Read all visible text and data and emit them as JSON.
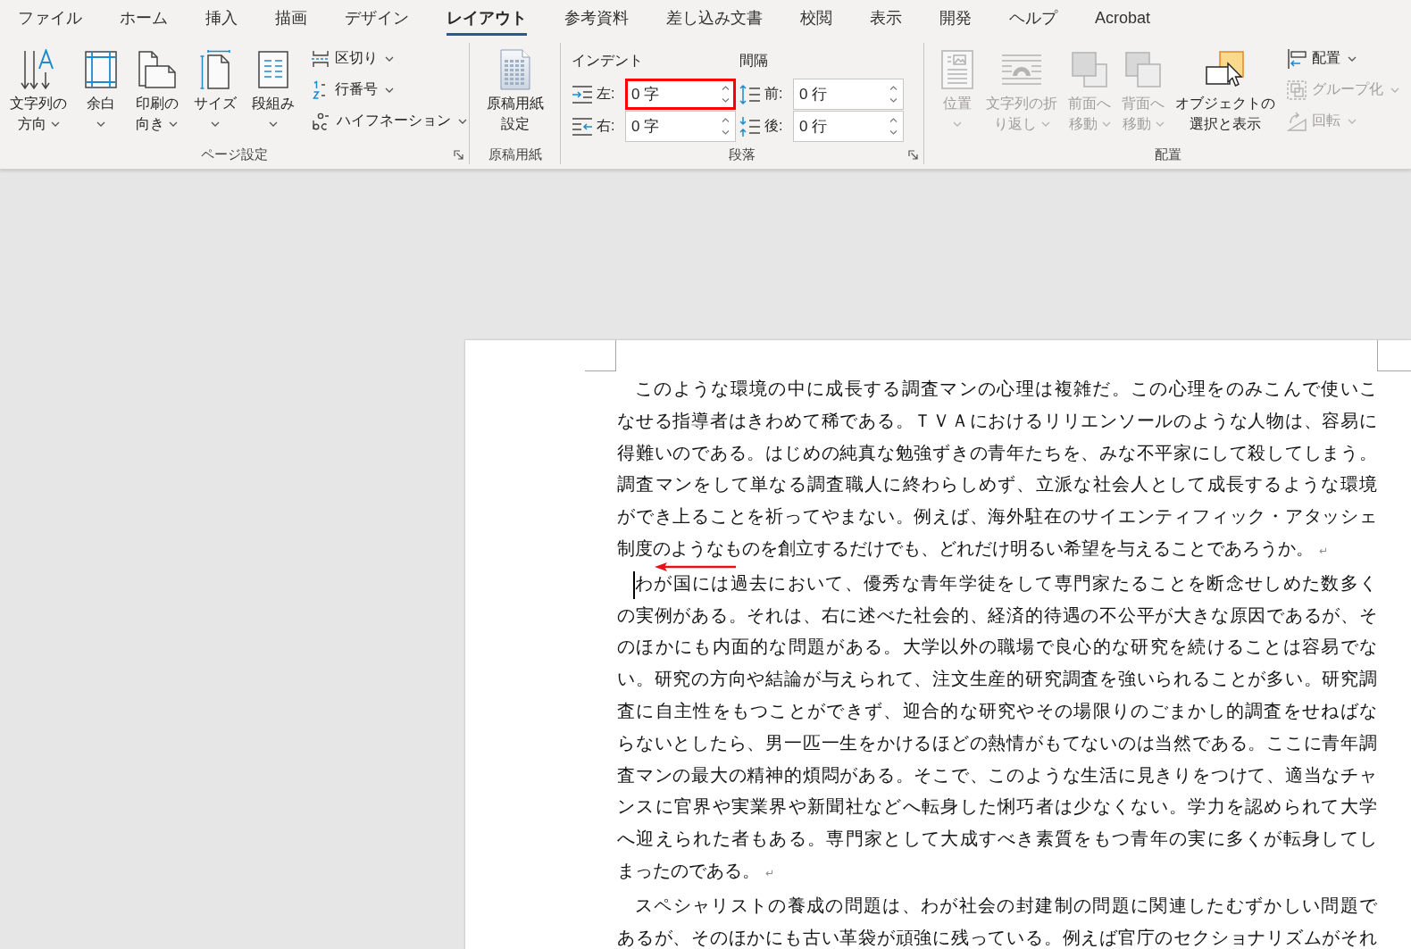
{
  "tabs": [
    {
      "label": "ファイル",
      "selected": false
    },
    {
      "label": "ホーム",
      "selected": false
    },
    {
      "label": "挿入",
      "selected": false
    },
    {
      "label": "描画",
      "selected": false
    },
    {
      "label": "デザイン",
      "selected": false
    },
    {
      "label": "レイアウト",
      "selected": true
    },
    {
      "label": "参考資料",
      "selected": false
    },
    {
      "label": "差し込み文書",
      "selected": false
    },
    {
      "label": "校閲",
      "selected": false
    },
    {
      "label": "表示",
      "selected": false
    },
    {
      "label": "開発",
      "selected": false
    },
    {
      "label": "ヘルプ",
      "selected": false
    },
    {
      "label": "Acrobat",
      "selected": false
    }
  ],
  "ribbon": {
    "groups": [
      {
        "kind": "buttons",
        "label": "ページ設定",
        "launcher": true,
        "large_buttons": [
          {
            "lines": [
              "文字列の",
              "方向"
            ],
            "dropdown": true,
            "disabled": false
          },
          {
            "lines": [
              "余白"
            ],
            "dropdown": true,
            "disabled": false
          },
          {
            "lines": [
              "印刷の",
              "向き"
            ],
            "dropdown": true,
            "disabled": false
          },
          {
            "lines": [
              "サイズ"
            ],
            "dropdown": true,
            "disabled": false
          },
          {
            "lines": [
              "段組み"
            ],
            "dropdown": true,
            "disabled": false
          }
        ],
        "small_buttons": [
          {
            "label": "区切り",
            "dropdown": true,
            "disabled": false
          },
          {
            "label": "行番号",
            "dropdown": true,
            "disabled": false
          },
          {
            "label": "ハイフネーション",
            "dropdown": true,
            "disabled": false
          }
        ]
      },
      {
        "kind": "buttons",
        "label": "原稿用紙",
        "large_buttons": [
          {
            "lines": [
              "原稿用紙",
              "設定"
            ],
            "dropdown": false,
            "disabled": false
          }
        ]
      },
      {
        "kind": "paragraph",
        "label": "段落",
        "launcher": true,
        "indent": {
          "title": "インデント",
          "fields": [
            {
              "label": "左:",
              "value": "0 字",
              "highlighted": true
            },
            {
              "label": "右:",
              "value": "0 字",
              "highlighted": false
            }
          ]
        },
        "spacing": {
          "title": "間隔",
          "fields": [
            {
              "label": "前:",
              "value": "0 行",
              "highlighted": false
            },
            {
              "label": "後:",
              "value": "0 行",
              "highlighted": false
            }
          ]
        }
      },
      {
        "kind": "buttons",
        "label": "配置",
        "large_buttons": [
          {
            "lines": [
              "位置"
            ],
            "dropdown": true,
            "disabled": true
          },
          {
            "lines": [
              "文字列の折",
              "り返し"
            ],
            "dropdown": true,
            "disabled": true
          },
          {
            "lines": [
              "前面へ",
              "移動"
            ],
            "dropdown": true,
            "disabled": true
          },
          {
            "lines": [
              "背面へ",
              "移動"
            ],
            "dropdown": true,
            "disabled": true
          },
          {
            "lines": [
              "オブジェクトの",
              "選択と表示"
            ],
            "dropdown": false,
            "disabled": false
          }
        ],
        "small_buttons": [
          {
            "label": "配置",
            "dropdown": true,
            "disabled": false
          },
          {
            "label": "グループ化",
            "dropdown": true,
            "disabled": true
          },
          {
            "label": "回転",
            "dropdown": true,
            "disabled": true
          }
        ]
      }
    ]
  },
  "document": {
    "annotation_arrow": true,
    "paragraphs": [
      {
        "cursor": false,
        "end_mark": "↵",
        "lines": [
          "このような環境の中に成長する調査マンの心理は複雑だ。この心理をのみこんで使いこ",
          "なせる指導者はきわめて稀である。ＴＶＡにおけるリリエンソールのような人物は、容易に",
          "得難いのである。はじめの純真な勉強ずきの青年たちを、みな不平家にして殺してしまう。",
          "調査マンをして単なる調査職人に終わらしめず、立派な社会人として成長するような環境",
          "ができ上ることを祈ってやまない。例えば、海外駐在のサイエンティフィック・アタッシェ",
          "制度のようなものを創立するだけでも、どれだけ明るい希望を与えることであろうか。"
        ]
      },
      {
        "cursor": true,
        "end_mark": "↵",
        "lines": [
          "わが国には過去において、優秀な青年学徒をして専門家たることを断念せしめた数多く",
          "の実例がある。それは、右に述べた社会的、経済的待遇の不公平が大きな原因であるが、そ",
          "のほかにも内面的な問題がある。大学以外の職場で良心的な研究を続けることは容易でな",
          "い。研究の方向や結論が与えられて、注文生産的研究調査を強いられることが多い。研究調",
          "査に自主性をもつことができず、迎合的な研究やその場限りのごまかし的調査をせねばな",
          "らないとしたら、男一匹一生をかけるほどの熱情がもてないのは当然である。ここに青年調",
          "査マンの最大の精神的煩悶がある。そこで、このような生活に見きりをつけて、適当なチャ",
          "ンスに官界や実業界や新聞社などへ転身した悧巧者は少なくない。学力を認められて大学",
          "へ迎えられた者もある。専門家として大成すべき素質をもつ青年の実に多くが転身してし",
          "まったのである。"
        ]
      },
      {
        "cursor": false,
        "lines": [
          "スペシャリストの養成の問題は、わが社会の封建制の問題に関連したむずかしい問題で",
          "あるが、そのほかにも古い革袋が頑強に残っている。例えば官庁のセクショナリズムがそれ"
        ]
      }
    ]
  }
}
